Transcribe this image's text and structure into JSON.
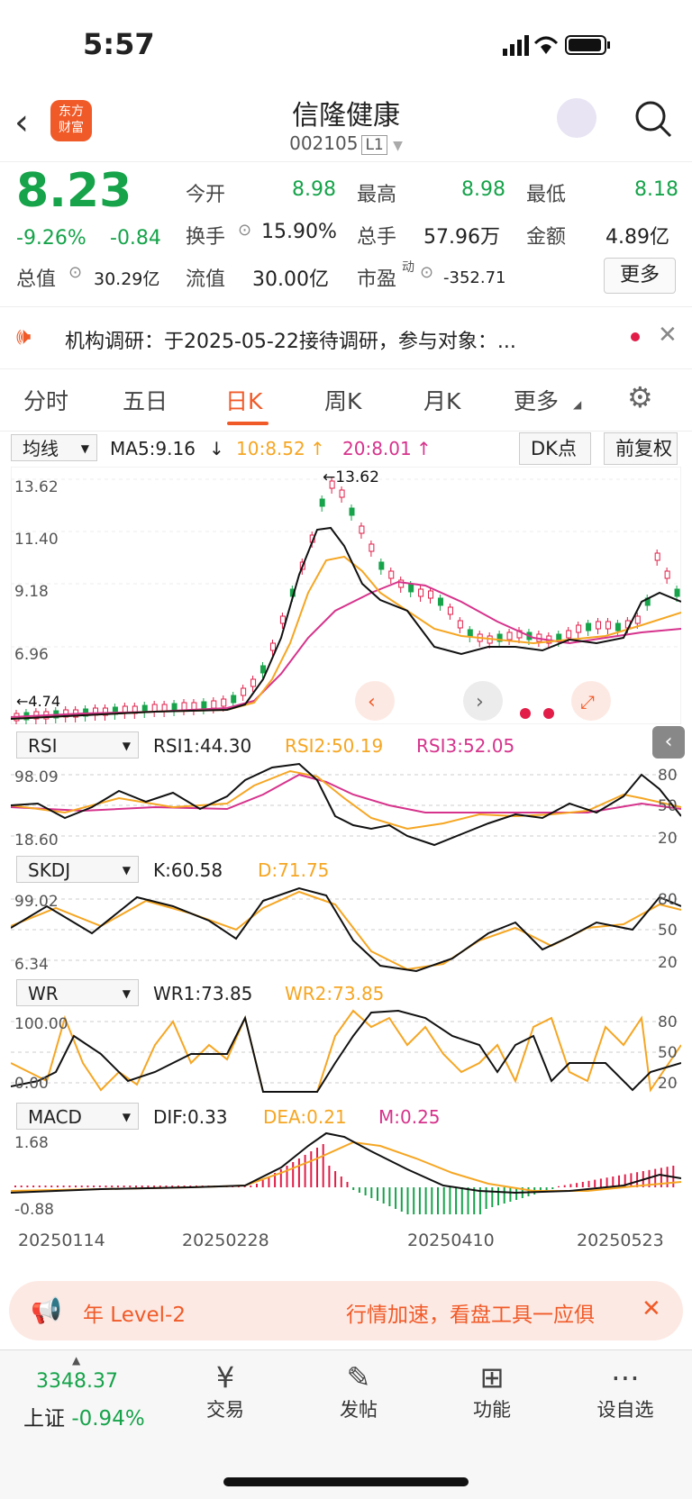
{
  "status": {
    "time": "5:57"
  },
  "header": {
    "title": "信隆健康",
    "code": "002105",
    "level": "L1",
    "logo_line1": "东方",
    "logo_line2": "财富"
  },
  "quote": {
    "price": "8.23",
    "change_pct": "-9.26%",
    "change": "-0.84",
    "open_label": "今开",
    "open": "8.98",
    "high_label": "最高",
    "high": "8.98",
    "low_label": "最低",
    "low": "8.18",
    "turnover_label": "换手",
    "turnover": "15.90%",
    "volume_label": "总手",
    "volume": "57.96万",
    "amount_label": "金额",
    "amount": "4.89亿",
    "mktcap_label": "总值",
    "mktcap": "30.29亿",
    "float_label": "流值",
    "float": "30.00亿",
    "pe_label": "市盈",
    "pe_sup": "动",
    "pe": "-352.71",
    "more": "更多"
  },
  "notice": {
    "text": "机构调研：于2025-05-22接待调研，参与对象：..."
  },
  "tabs": [
    "分时",
    "五日",
    "日K",
    "周K",
    "月K",
    "更多"
  ],
  "kline": {
    "ma_select": "均线",
    "ma5": "MA5:9.16",
    "ma10": "10:8.52",
    "ma20": "20:8.01",
    "dk": "DK点",
    "fq": "前复权",
    "y_labels": [
      "13.62",
      "11.40",
      "9.18",
      "6.96"
    ],
    "peak_label": "13.62",
    "low_label": "4.74"
  },
  "rsi": {
    "select": "RSI",
    "v1": "RSI1:44.30",
    "v2": "RSI2:50.19",
    "v3": "RSI3:52.05",
    "top": "98.09",
    "bottom": "18.60",
    "levels": [
      "80",
      "50",
      "20"
    ]
  },
  "kdj": {
    "select": "SKDJ",
    "k": "K:60.58",
    "d": "D:71.75",
    "top": "99.02",
    "bottom": "6.34",
    "levels": [
      "80",
      "50",
      "20"
    ]
  },
  "wr": {
    "select": "WR",
    "v1": "WR1:73.85",
    "v2": "WR2:73.85",
    "top": "100.00",
    "bottom": "0.00",
    "levels": [
      "80",
      "50",
      "20"
    ]
  },
  "macd": {
    "select": "MACD",
    "dif": "DIF:0.33",
    "dea": "DEA:0.21",
    "m": "M:0.25",
    "top": "1.68",
    "bottom": "-0.88"
  },
  "dates": [
    "20250114",
    "20250228",
    "20250410",
    "20250523"
  ],
  "ad": {
    "left": "年 Level-2",
    "right": "行情加速，看盘工具一应俱"
  },
  "bottom": {
    "index_value": "3348.37",
    "index_name": "上证",
    "index_change": "-0.94%",
    "items": [
      "交易",
      "发帖",
      "功能",
      "设自选"
    ]
  }
}
